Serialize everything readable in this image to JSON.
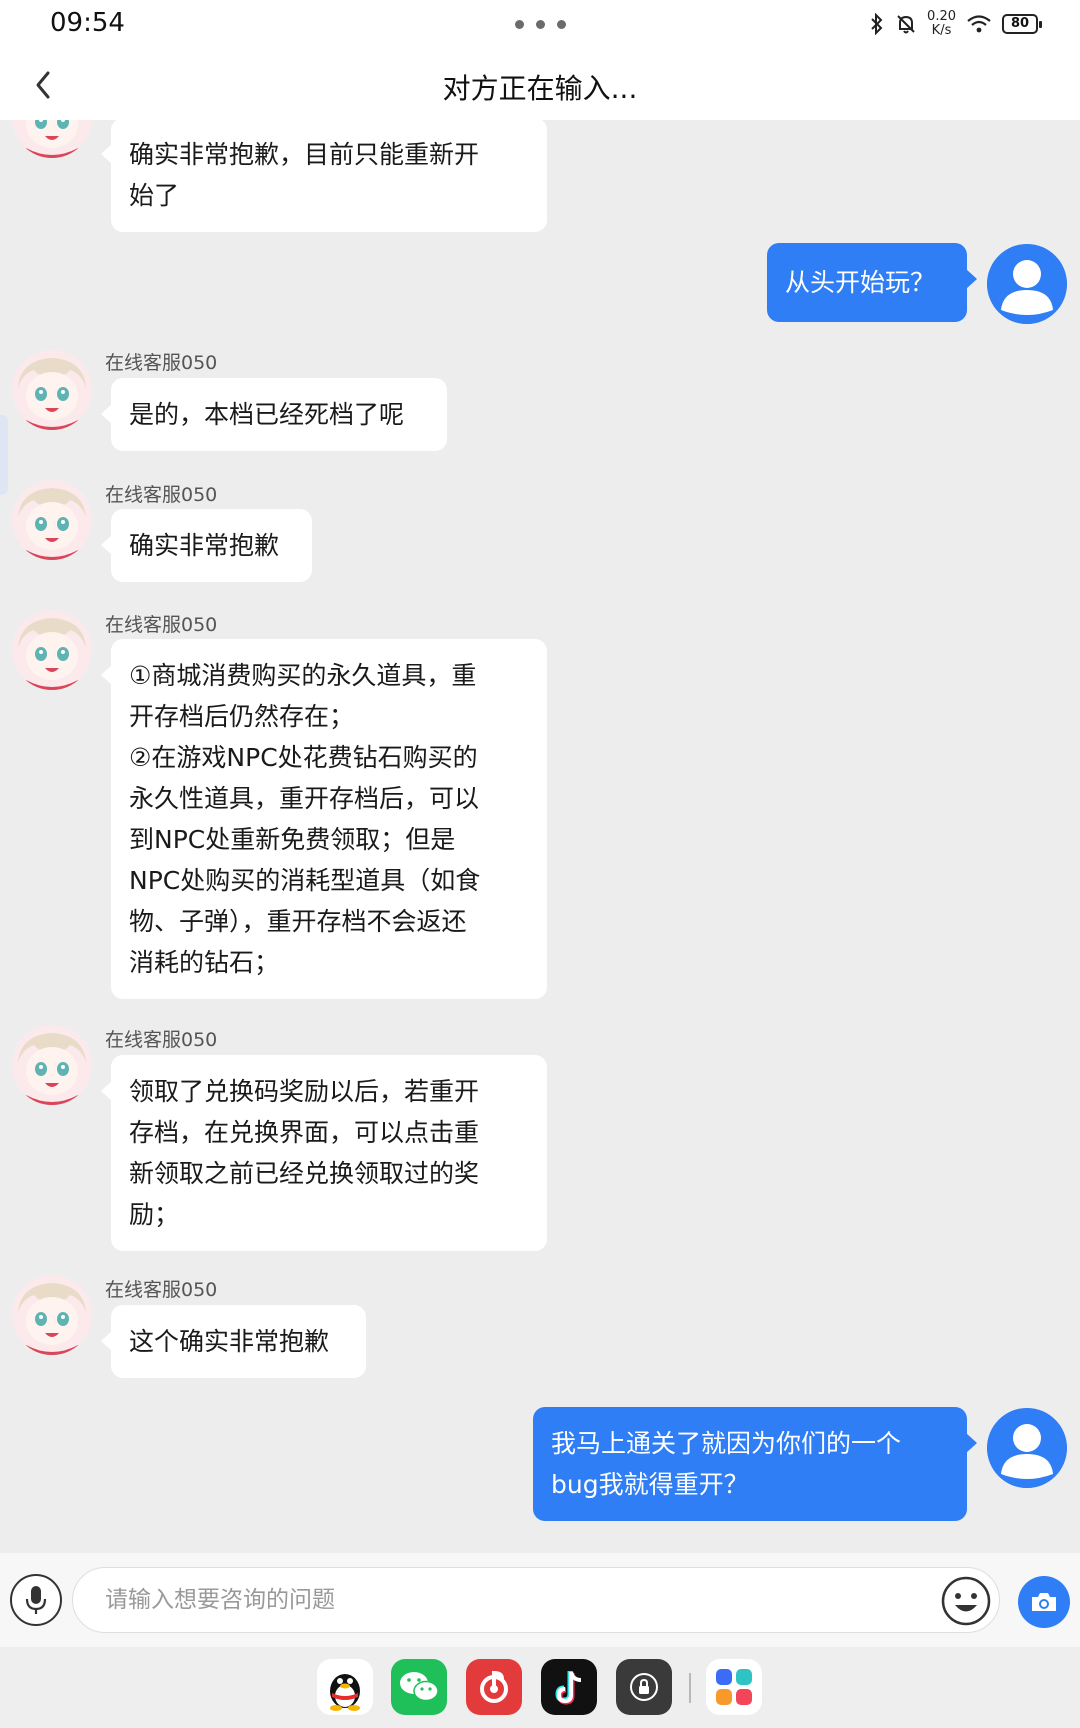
{
  "status_bar": {
    "time": "09:54",
    "net_speed_value": "0.20",
    "net_speed_unit": "K/s",
    "battery": "80"
  },
  "header": {
    "title": "对方正在输入..."
  },
  "agent": {
    "name": "在线客服050"
  },
  "messages": [
    {
      "from": "agent",
      "text": "确实非常抱歉，目前只能重新开\n始了"
    },
    {
      "from": "user",
      "text": "从头开始玩？"
    },
    {
      "from": "agent",
      "text": "是的，本档已经死档了呢"
    },
    {
      "from": "agent",
      "text": "确实非常抱歉"
    },
    {
      "from": "agent",
      "text": "①商城消费购买的永久道具，重\n开存档后仍然存在；\n②在游戏NPC处花费钻石购买的\n永久性道具，重开存档后，可以\n到NPC处重新免费领取；但是\nNPC处购买的消耗型道具（如食\n物、子弹），重开存档不会返还\n消耗的钻石；"
    },
    {
      "from": "agent",
      "text": "领取了兑换码奖励以后，若重开\n存档，在兑换界面，可以点击重\n新领取之前已经兑换领取过的奖\n励；"
    },
    {
      "from": "agent",
      "text": "这个确实非常抱歉"
    },
    {
      "from": "user",
      "text": "我马上通关了就因为你们的一个\nbug我就得重开？"
    }
  ],
  "input": {
    "placeholder": "请输入想要咨询的问题"
  },
  "dock": {
    "apps": [
      "qq-icon",
      "wechat-icon",
      "netease-music-icon",
      "tiktok-icon",
      "screen-lock-icon",
      "app-drawer-icon"
    ]
  },
  "colors": {
    "user_bubble": "#2f7ef5",
    "background": "#ededed"
  }
}
